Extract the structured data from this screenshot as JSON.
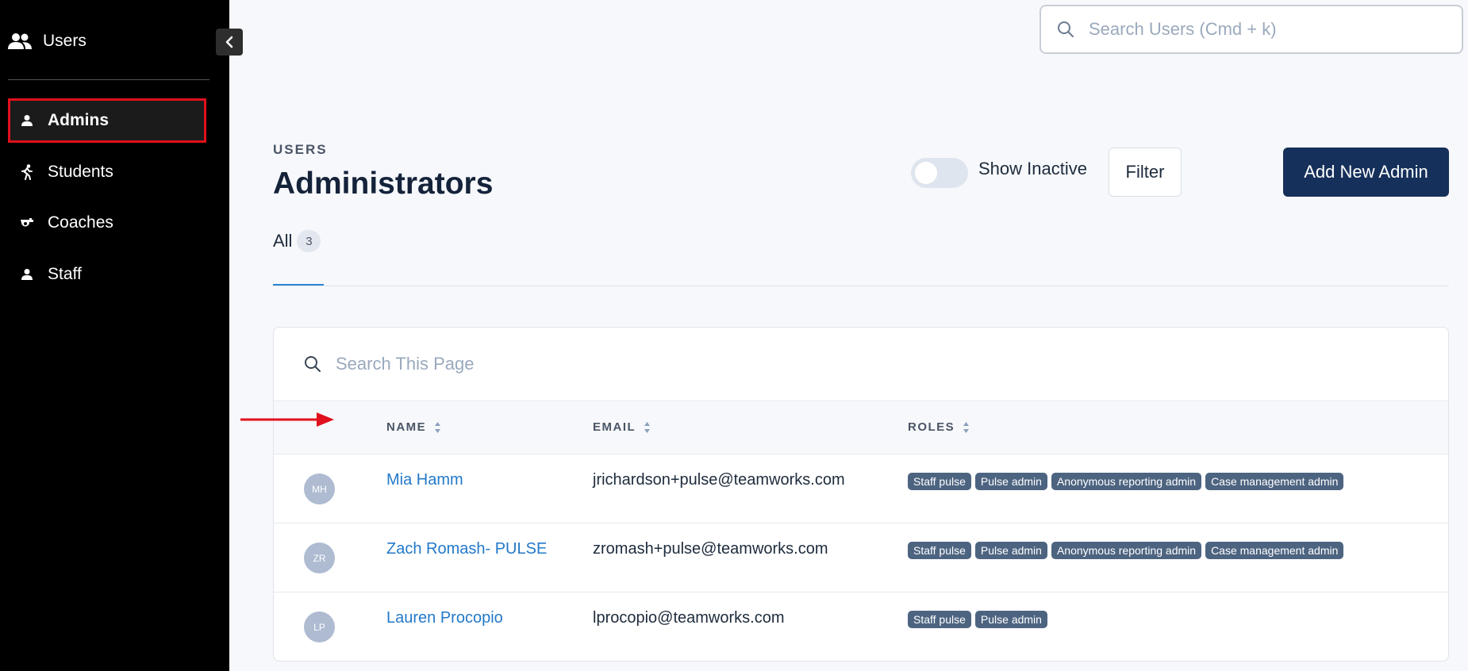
{
  "sidebar": {
    "title": "Users",
    "items": [
      {
        "label": "Admins",
        "active": true,
        "icon": "person-icon"
      },
      {
        "label": "Students",
        "active": false,
        "icon": "runner-icon"
      },
      {
        "label": "Coaches",
        "active": false,
        "icon": "whistle-icon"
      },
      {
        "label": "Staff",
        "active": false,
        "icon": "person-icon"
      }
    ]
  },
  "search": {
    "placeholder": "Search Users (Cmd + k)"
  },
  "header": {
    "overline": "USERS",
    "title": "Administrators",
    "toggle_label": "Show Inactive",
    "toggle_on": false,
    "filter_label": "Filter",
    "add_label": "Add New Admin"
  },
  "tabs": [
    {
      "label": "All",
      "count": "3"
    }
  ],
  "table": {
    "search_placeholder": "Search This Page",
    "columns": [
      "NAME",
      "EMAIL",
      "ROLES"
    ],
    "rows": [
      {
        "initials": "MH",
        "name": "Mia Hamm",
        "email": "jrichardson+pulse@teamworks.com",
        "roles": [
          "Staff pulse",
          "Pulse admin",
          "Anonymous reporting admin",
          "Case management admin"
        ]
      },
      {
        "initials": "ZR",
        "name": "Zach Romash- PULSE",
        "email": "zromash+pulse@teamworks.com",
        "roles": [
          "Staff pulse",
          "Pulse admin",
          "Anonymous reporting admin",
          "Case management admin"
        ]
      },
      {
        "initials": "LP",
        "name": "Lauren Procopio",
        "email": "lprocopio@teamworks.com",
        "roles": [
          "Staff pulse",
          "Pulse admin"
        ]
      }
    ]
  },
  "colors": {
    "sidebar_bg": "#000000",
    "active_outline": "#e0101c",
    "primary_button": "#15305a",
    "link": "#2379c9",
    "badge": "#4d6481",
    "annotation_arrow": "#e0101c"
  }
}
